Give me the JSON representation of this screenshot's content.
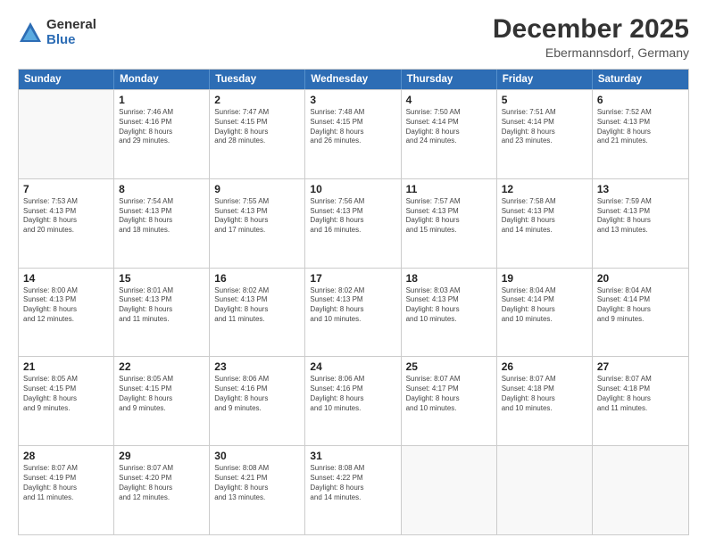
{
  "logo": {
    "general": "General",
    "blue": "Blue"
  },
  "title": "December 2025",
  "subtitle": "Ebermannsdorf, Germany",
  "header_days": [
    "Sunday",
    "Monday",
    "Tuesday",
    "Wednesday",
    "Thursday",
    "Friday",
    "Saturday"
  ],
  "weeks": [
    [
      {
        "day": "",
        "lines": []
      },
      {
        "day": "1",
        "lines": [
          "Sunrise: 7:46 AM",
          "Sunset: 4:16 PM",
          "Daylight: 8 hours",
          "and 29 minutes."
        ]
      },
      {
        "day": "2",
        "lines": [
          "Sunrise: 7:47 AM",
          "Sunset: 4:15 PM",
          "Daylight: 8 hours",
          "and 28 minutes."
        ]
      },
      {
        "day": "3",
        "lines": [
          "Sunrise: 7:48 AM",
          "Sunset: 4:15 PM",
          "Daylight: 8 hours",
          "and 26 minutes."
        ]
      },
      {
        "day": "4",
        "lines": [
          "Sunrise: 7:50 AM",
          "Sunset: 4:14 PM",
          "Daylight: 8 hours",
          "and 24 minutes."
        ]
      },
      {
        "day": "5",
        "lines": [
          "Sunrise: 7:51 AM",
          "Sunset: 4:14 PM",
          "Daylight: 8 hours",
          "and 23 minutes."
        ]
      },
      {
        "day": "6",
        "lines": [
          "Sunrise: 7:52 AM",
          "Sunset: 4:13 PM",
          "Daylight: 8 hours",
          "and 21 minutes."
        ]
      }
    ],
    [
      {
        "day": "7",
        "lines": [
          "Sunrise: 7:53 AM",
          "Sunset: 4:13 PM",
          "Daylight: 8 hours",
          "and 20 minutes."
        ]
      },
      {
        "day": "8",
        "lines": [
          "Sunrise: 7:54 AM",
          "Sunset: 4:13 PM",
          "Daylight: 8 hours",
          "and 18 minutes."
        ]
      },
      {
        "day": "9",
        "lines": [
          "Sunrise: 7:55 AM",
          "Sunset: 4:13 PM",
          "Daylight: 8 hours",
          "and 17 minutes."
        ]
      },
      {
        "day": "10",
        "lines": [
          "Sunrise: 7:56 AM",
          "Sunset: 4:13 PM",
          "Daylight: 8 hours",
          "and 16 minutes."
        ]
      },
      {
        "day": "11",
        "lines": [
          "Sunrise: 7:57 AM",
          "Sunset: 4:13 PM",
          "Daylight: 8 hours",
          "and 15 minutes."
        ]
      },
      {
        "day": "12",
        "lines": [
          "Sunrise: 7:58 AM",
          "Sunset: 4:13 PM",
          "Daylight: 8 hours",
          "and 14 minutes."
        ]
      },
      {
        "day": "13",
        "lines": [
          "Sunrise: 7:59 AM",
          "Sunset: 4:13 PM",
          "Daylight: 8 hours",
          "and 13 minutes."
        ]
      }
    ],
    [
      {
        "day": "14",
        "lines": [
          "Sunrise: 8:00 AM",
          "Sunset: 4:13 PM",
          "Daylight: 8 hours",
          "and 12 minutes."
        ]
      },
      {
        "day": "15",
        "lines": [
          "Sunrise: 8:01 AM",
          "Sunset: 4:13 PM",
          "Daylight: 8 hours",
          "and 11 minutes."
        ]
      },
      {
        "day": "16",
        "lines": [
          "Sunrise: 8:02 AM",
          "Sunset: 4:13 PM",
          "Daylight: 8 hours",
          "and 11 minutes."
        ]
      },
      {
        "day": "17",
        "lines": [
          "Sunrise: 8:02 AM",
          "Sunset: 4:13 PM",
          "Daylight: 8 hours",
          "and 10 minutes."
        ]
      },
      {
        "day": "18",
        "lines": [
          "Sunrise: 8:03 AM",
          "Sunset: 4:13 PM",
          "Daylight: 8 hours",
          "and 10 minutes."
        ]
      },
      {
        "day": "19",
        "lines": [
          "Sunrise: 8:04 AM",
          "Sunset: 4:14 PM",
          "Daylight: 8 hours",
          "and 10 minutes."
        ]
      },
      {
        "day": "20",
        "lines": [
          "Sunrise: 8:04 AM",
          "Sunset: 4:14 PM",
          "Daylight: 8 hours",
          "and 9 minutes."
        ]
      }
    ],
    [
      {
        "day": "21",
        "lines": [
          "Sunrise: 8:05 AM",
          "Sunset: 4:15 PM",
          "Daylight: 8 hours",
          "and 9 minutes."
        ]
      },
      {
        "day": "22",
        "lines": [
          "Sunrise: 8:05 AM",
          "Sunset: 4:15 PM",
          "Daylight: 8 hours",
          "and 9 minutes."
        ]
      },
      {
        "day": "23",
        "lines": [
          "Sunrise: 8:06 AM",
          "Sunset: 4:16 PM",
          "Daylight: 8 hours",
          "and 9 minutes."
        ]
      },
      {
        "day": "24",
        "lines": [
          "Sunrise: 8:06 AM",
          "Sunset: 4:16 PM",
          "Daylight: 8 hours",
          "and 10 minutes."
        ]
      },
      {
        "day": "25",
        "lines": [
          "Sunrise: 8:07 AM",
          "Sunset: 4:17 PM",
          "Daylight: 8 hours",
          "and 10 minutes."
        ]
      },
      {
        "day": "26",
        "lines": [
          "Sunrise: 8:07 AM",
          "Sunset: 4:18 PM",
          "Daylight: 8 hours",
          "and 10 minutes."
        ]
      },
      {
        "day": "27",
        "lines": [
          "Sunrise: 8:07 AM",
          "Sunset: 4:18 PM",
          "Daylight: 8 hours",
          "and 11 minutes."
        ]
      }
    ],
    [
      {
        "day": "28",
        "lines": [
          "Sunrise: 8:07 AM",
          "Sunset: 4:19 PM",
          "Daylight: 8 hours",
          "and 11 minutes."
        ]
      },
      {
        "day": "29",
        "lines": [
          "Sunrise: 8:07 AM",
          "Sunset: 4:20 PM",
          "Daylight: 8 hours",
          "and 12 minutes."
        ]
      },
      {
        "day": "30",
        "lines": [
          "Sunrise: 8:08 AM",
          "Sunset: 4:21 PM",
          "Daylight: 8 hours",
          "and 13 minutes."
        ]
      },
      {
        "day": "31",
        "lines": [
          "Sunrise: 8:08 AM",
          "Sunset: 4:22 PM",
          "Daylight: 8 hours",
          "and 14 minutes."
        ]
      },
      {
        "day": "",
        "lines": []
      },
      {
        "day": "",
        "lines": []
      },
      {
        "day": "",
        "lines": []
      }
    ]
  ]
}
